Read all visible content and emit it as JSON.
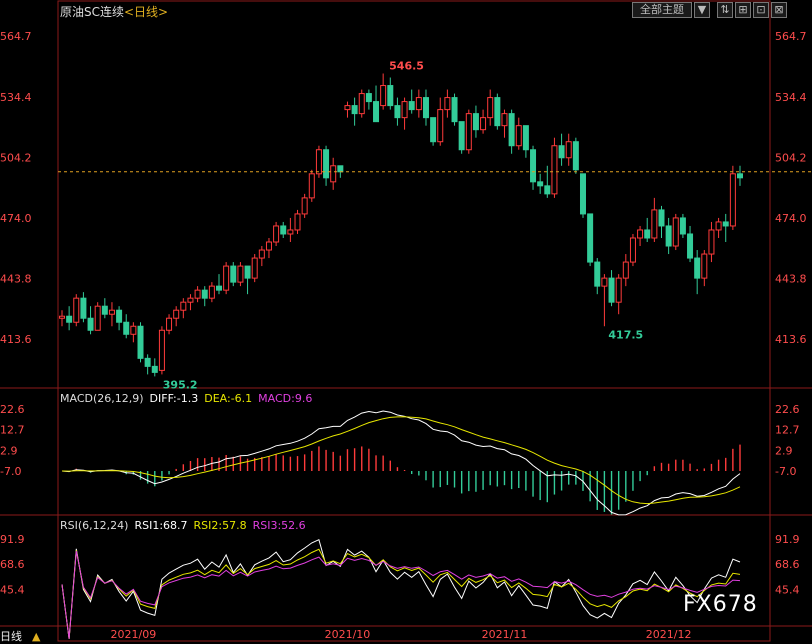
{
  "header": {
    "title": "原油SC连续",
    "period": "<日线>",
    "theme_button": "全部主题",
    "theme_arrow": "▼",
    "ctrl_buttons": [
      "⇅",
      "⊞",
      "⊡",
      "⊠"
    ]
  },
  "colors": {
    "up": "#ff3b3b",
    "down": "#33cc99",
    "ma1": "#ffffff",
    "ma2": "#e6e600",
    "ma3": "#e040e0",
    "axis": "#ff4d4d",
    "grid": "#8b1a1a"
  },
  "price_axis": [
    "564.7",
    "534.4",
    "504.2",
    "474.0",
    "443.8",
    "413.6"
  ],
  "macd_axis": [
    "22.6",
    "12.7",
    "2.9",
    "-7.0"
  ],
  "rsi_axis": [
    "91.9",
    "68.6",
    "45.4"
  ],
  "annotations": {
    "high": "546.5",
    "low_left": "395.2",
    "low_right": "417.5"
  },
  "macd_header": {
    "name": "MACD(26,12,9)",
    "diff": "DIFF:-1.3",
    "dea": "DEA:-6.1",
    "macd": "MACD:9.6"
  },
  "rsi_header": {
    "name": "RSI(6,12,24)",
    "rsi1": "RSI1:68.7",
    "rsi2": "RSI2:57.8",
    "rsi3": "RSI3:52.6"
  },
  "x_labels": [
    "2021/09",
    "2021/10",
    "2021/11",
    "2021/12"
  ],
  "footer": {
    "period_button": "日线",
    "brand": "FX678"
  },
  "chart_data": {
    "type": "candlestick",
    "current_price": 497,
    "ylim": [
      395,
      565
    ],
    "candles": [
      [
        424,
        428,
        420,
        425
      ],
      [
        425,
        430,
        418,
        422
      ],
      [
        422,
        436,
        420,
        434
      ],
      [
        434,
        437,
        422,
        424
      ],
      [
        424,
        430,
        416,
        418
      ],
      [
        418,
        432,
        418,
        430
      ],
      [
        430,
        434,
        424,
        426
      ],
      [
        426,
        432,
        420,
        428
      ],
      [
        428,
        430,
        418,
        422
      ],
      [
        422,
        426,
        414,
        416
      ],
      [
        416,
        422,
        412,
        420
      ],
      [
        420,
        422,
        402,
        404
      ],
      [
        404,
        406,
        396,
        400
      ],
      [
        400,
        404,
        395,
        397
      ],
      [
        398,
        420,
        396,
        418
      ],
      [
        418,
        426,
        416,
        424
      ],
      [
        424,
        430,
        420,
        428
      ],
      [
        428,
        434,
        424,
        432
      ],
      [
        432,
        436,
        428,
        434
      ],
      [
        434,
        440,
        432,
        438
      ],
      [
        438,
        440,
        430,
        434
      ],
      [
        434,
        442,
        432,
        440
      ],
      [
        440,
        446,
        436,
        438
      ],
      [
        438,
        452,
        436,
        450
      ],
      [
        450,
        452,
        440,
        442
      ],
      [
        442,
        452,
        440,
        450
      ],
      [
        450,
        450,
        436,
        444
      ],
      [
        444,
        456,
        442,
        454
      ],
      [
        454,
        460,
        450,
        458
      ],
      [
        458,
        464,
        454,
        462
      ],
      [
        462,
        472,
        460,
        470
      ],
      [
        470,
        472,
        464,
        466
      ],
      [
        466,
        474,
        462,
        468
      ],
      [
        468,
        478,
        466,
        476
      ],
      [
        476,
        486,
        474,
        484
      ],
      [
        484,
        498,
        482,
        496
      ],
      [
        496,
        510,
        494,
        508
      ],
      [
        508,
        510,
        490,
        494
      ],
      [
        492,
        504,
        488,
        500
      ],
      [
        500,
        500,
        494,
        497
      ],
      [
        528,
        532,
        524,
        530
      ],
      [
        530,
        534,
        520,
        526
      ],
      [
        526,
        538,
        524,
        536
      ],
      [
        536,
        538,
        528,
        532
      ],
      [
        532,
        540,
        528,
        522
      ],
      [
        530,
        546,
        528,
        540
      ],
      [
        540,
        544,
        528,
        530
      ],
      [
        530,
        534,
        520,
        524
      ],
      [
        524,
        534,
        518,
        532
      ],
      [
        532,
        538,
        526,
        528
      ],
      [
        528,
        538,
        524,
        534
      ],
      [
        534,
        538,
        520,
        524
      ],
      [
        524,
        524,
        510,
        512
      ],
      [
        512,
        534,
        510,
        528
      ],
      [
        528,
        538,
        524,
        534
      ],
      [
        534,
        536,
        520,
        522
      ],
      [
        522,
        522,
        506,
        508
      ],
      [
        508,
        528,
        506,
        526
      ],
      [
        526,
        530,
        514,
        518
      ],
      [
        518,
        528,
        516,
        524
      ],
      [
        524,
        538,
        520,
        534
      ],
      [
        534,
        536,
        518,
        520
      ],
      [
        520,
        528,
        514,
        526
      ],
      [
        526,
        528,
        506,
        510
      ],
      [
        510,
        524,
        508,
        520
      ],
      [
        520,
        520,
        504,
        508
      ],
      [
        508,
        510,
        488,
        492
      ],
      [
        492,
        496,
        486,
        490
      ],
      [
        490,
        500,
        484,
        486
      ],
      [
        486,
        514,
        484,
        510
      ],
      [
        510,
        516,
        500,
        504
      ],
      [
        504,
        516,
        500,
        512
      ],
      [
        512,
        514,
        496,
        498
      ],
      [
        496,
        496,
        474,
        476
      ],
      [
        476,
        476,
        450,
        452
      ],
      [
        452,
        454,
        436,
        440
      ],
      [
        440,
        446,
        420,
        444
      ],
      [
        444,
        448,
        430,
        432
      ],
      [
        432,
        446,
        426,
        444
      ],
      [
        444,
        456,
        440,
        452
      ],
      [
        452,
        466,
        450,
        464
      ],
      [
        464,
        470,
        460,
        468
      ],
      [
        468,
        474,
        462,
        464
      ],
      [
        464,
        484,
        462,
        478
      ],
      [
        478,
        480,
        464,
        470
      ],
      [
        470,
        474,
        456,
        460
      ],
      [
        460,
        476,
        458,
        474
      ],
      [
        474,
        476,
        464,
        466
      ],
      [
        466,
        470,
        452,
        454
      ],
      [
        454,
        458,
        436,
        444
      ],
      [
        444,
        458,
        440,
        456
      ],
      [
        456,
        472,
        452,
        468
      ],
      [
        468,
        474,
        464,
        472
      ],
      [
        472,
        476,
        462,
        470
      ],
      [
        470,
        500,
        468,
        496
      ],
      [
        496,
        500,
        490,
        494
      ]
    ]
  }
}
